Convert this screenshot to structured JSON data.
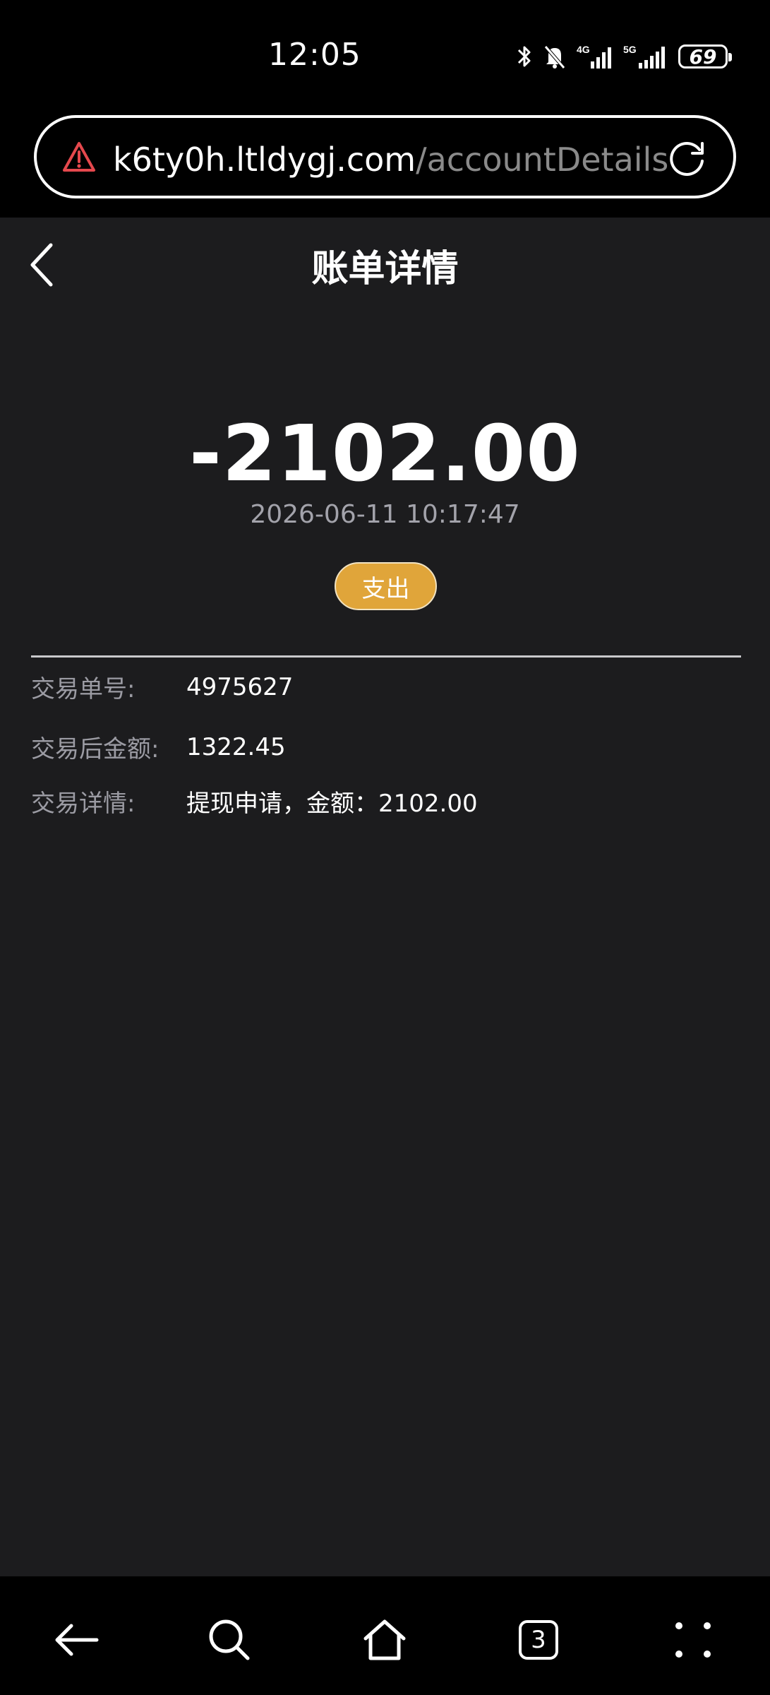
{
  "status_bar": {
    "time": "12:05",
    "battery": "69",
    "network_1": "4G",
    "network_2": "5G",
    "icons": [
      "bluetooth-icon",
      "bell-muted-icon",
      "signal-icon",
      "signal-icon",
      "battery-icon"
    ]
  },
  "browser": {
    "url_host": "k6ty0h.ltldygj.com",
    "url_path": "/accountDetails",
    "warning_color": "#e5484d"
  },
  "page": {
    "title": "账单详情",
    "amount": "-2102.00",
    "datetime": "2026-06-11 10:17:47",
    "type_badge": "支出",
    "badge_color": "#e0a53a",
    "details": [
      {
        "label": "交易单号:",
        "value": "4975627"
      },
      {
        "label": "交易后金额:",
        "value": "1322.45"
      },
      {
        "label": "交易详情:",
        "value": "提现申请，金额：2102.00"
      }
    ]
  },
  "bottom_nav": {
    "tab_count": "3",
    "items": [
      "back-icon",
      "search-icon",
      "home-icon",
      "tabs-icon",
      "more-icon"
    ]
  }
}
